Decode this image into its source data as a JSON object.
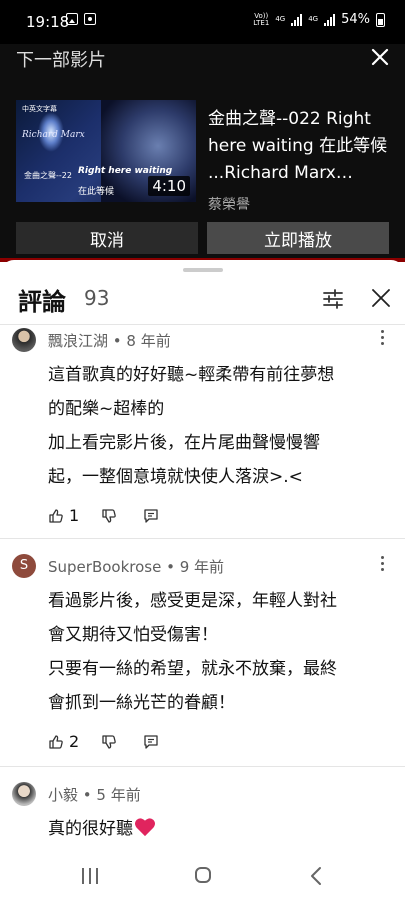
{
  "status_bar": {
    "time": "19:18",
    "network_label_top": "Vo))",
    "network_label_bottom": "LTE1",
    "network_type_1": "4G",
    "network_type_2": "4G",
    "battery": "54%"
  },
  "up_next": {
    "heading": "下一部影片",
    "thumbnail": {
      "brand_text": "中英文字幕",
      "artist_text": "Richard Marx",
      "series_text": "金曲之聲--22",
      "song_text": "Right here waiting",
      "song_zh_text": "在此等候"
    },
    "duration": "4:10",
    "video_title": "金曲之聲--022 Right here waiting 在此等候 ...Richard Marx…",
    "channel": "蔡榮譽",
    "cancel_label": "取消",
    "play_now_label": "立即播放"
  },
  "comments_panel": {
    "title": "評論",
    "count": "93",
    "comments": [
      {
        "author": "飄浪江湖",
        "time": "8 年前",
        "lines": [
          "這首歌真的好好聽~輕柔帶有前往夢想",
          "的配樂~超棒的",
          "加上看完影片後，在片尾曲聲慢慢響",
          "起，一整個意境就快使人落淚>.<"
        ],
        "likes": "1"
      },
      {
        "author": "SuperBookrose",
        "avatar_letter": "S",
        "time": "9 年前",
        "lines": [
          "看過影片後，感受更是深，年輕人對社",
          "會又期待又怕受傷害！",
          "只要有一絲的希望，就永不放棄，最終",
          "會抓到一絲光芒的眷顧！"
        ],
        "likes": "2"
      },
      {
        "author": "小毅",
        "time": "5 年前",
        "lines": [
          "真的很好聽"
        ]
      }
    ]
  },
  "colors": {
    "heart": "#e0245e",
    "accent_red_line": "#8b0000"
  },
  "icons": [
    "image-icon",
    "screen-record-icon",
    "signal-icon",
    "battery-icon",
    "close-icon",
    "filter-icon",
    "more-vert-icon",
    "thumb-up-icon",
    "thumb-down-icon",
    "reply-icon",
    "heart-icon",
    "nav-recents-icon",
    "nav-home-icon",
    "nav-back-icon"
  ]
}
